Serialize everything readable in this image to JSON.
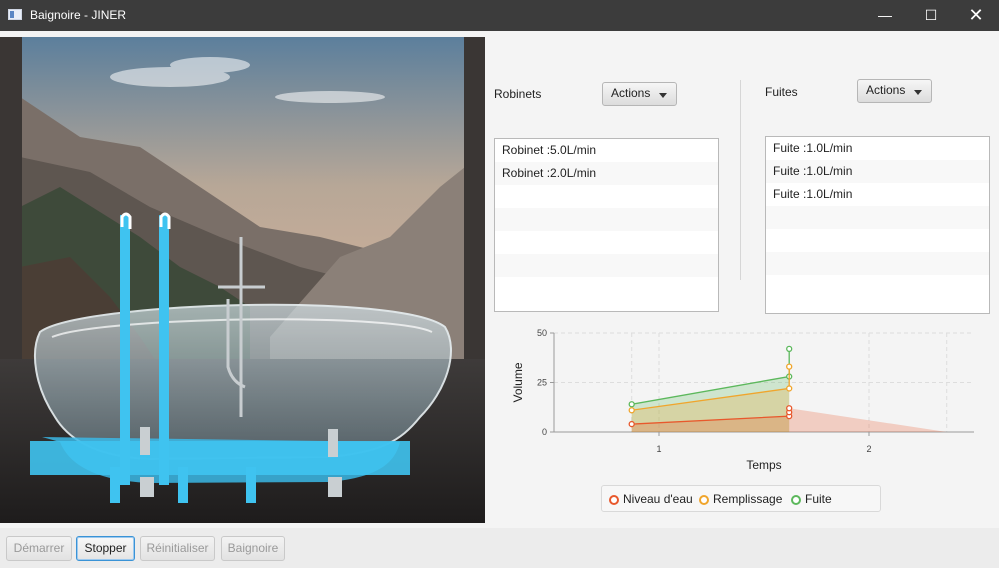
{
  "window": {
    "title": "Baignoire - JINER",
    "minimize_icon": "minimize-icon",
    "maximize_icon": "maximize-icon",
    "close_icon": "close-icon"
  },
  "taps": {
    "label": "Robinets",
    "actions_label": "Actions",
    "items": [
      "Robinet :5.0L/min",
      "Robinet :2.0L/min",
      "",
      "",
      "",
      "",
      ""
    ]
  },
  "leaks": {
    "label": "Fuites",
    "actions_label": "Actions",
    "items": [
      "Fuite :1.0L/min",
      "Fuite :1.0L/min",
      "Fuite :1.0L/min",
      "",
      "",
      "",
      ""
    ]
  },
  "chart_data": {
    "type": "area",
    "xlabel": "Temps",
    "ylabel": "Volume",
    "ylim": [
      0,
      50
    ],
    "xlim": [
      0.5,
      2.5
    ],
    "yticks": [
      0,
      25,
      50
    ],
    "xticks": [
      1,
      2
    ],
    "grid": true,
    "legend": "bottom",
    "series": [
      {
        "name": "Niveau d'eau",
        "color": "#e8582c",
        "points": [
          [
            0.87,
            4
          ],
          [
            1.62,
            8
          ],
          [
            1.62,
            10
          ],
          [
            1.62,
            12
          ]
        ],
        "fill_end": [
          2.37,
          0
        ]
      },
      {
        "name": "Remplissage",
        "color": "#f0a52c",
        "points": [
          [
            0.87,
            11
          ],
          [
            1.62,
            22
          ],
          [
            1.62,
            33
          ]
        ]
      },
      {
        "name": "Fuite",
        "color": "#5cb85c",
        "points": [
          [
            0.87,
            14
          ],
          [
            1.62,
            28
          ],
          [
            1.62,
            42
          ]
        ]
      }
    ]
  },
  "bottom_buttons": {
    "start": "Démarrer",
    "stop": "Stopper",
    "reset": "Réinitialiser",
    "bathtub": "Baignoire"
  }
}
